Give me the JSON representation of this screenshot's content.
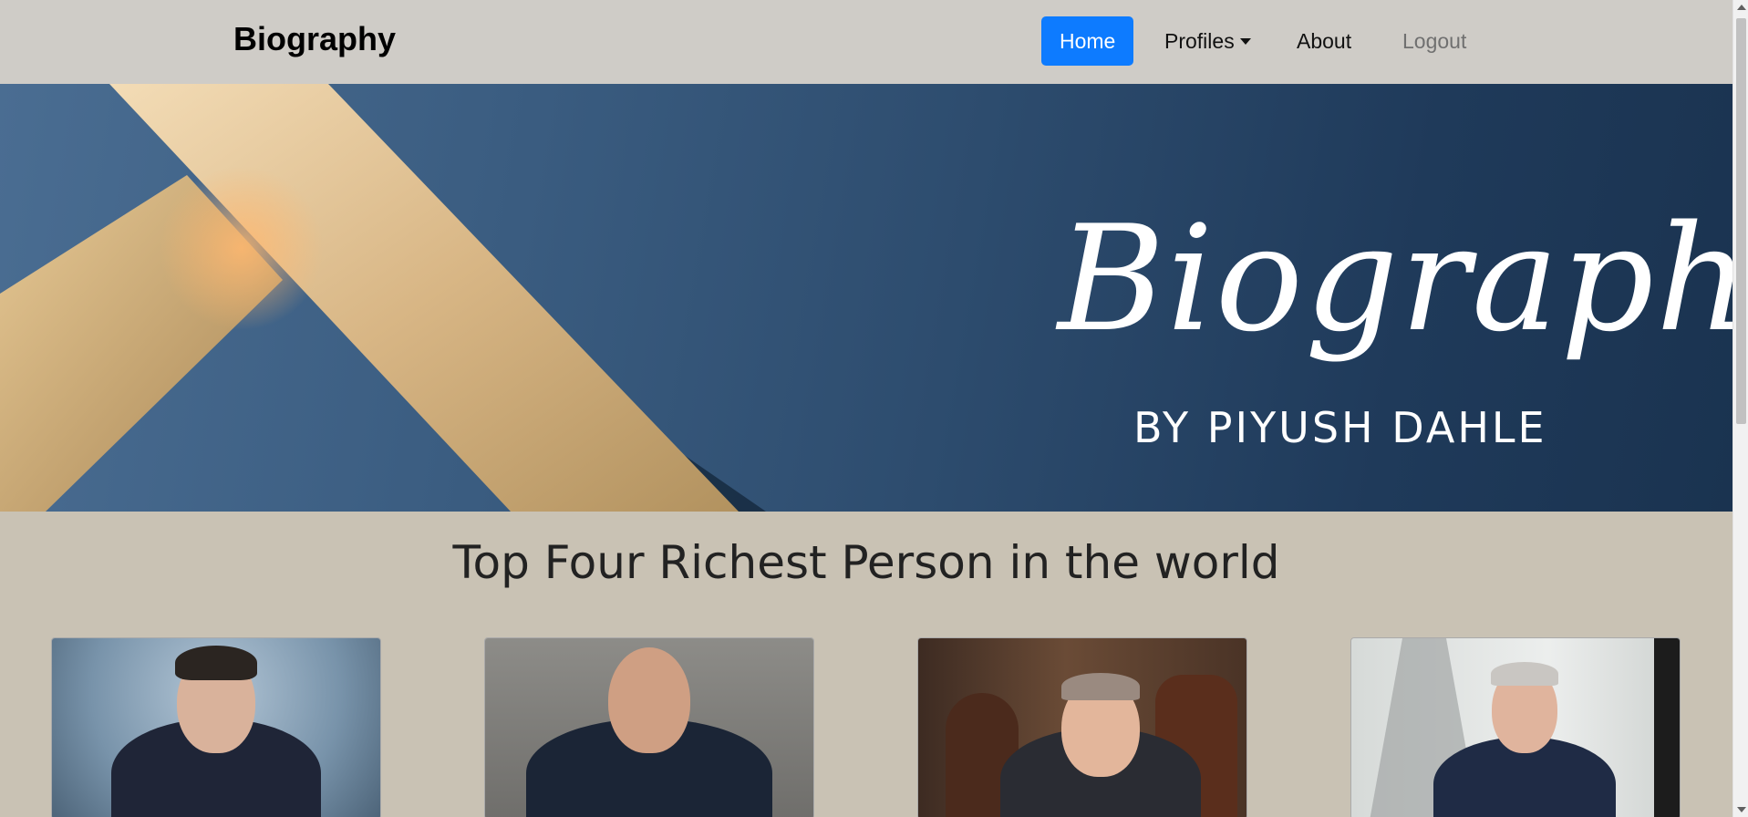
{
  "navbar": {
    "brand": "Biography",
    "links": [
      {
        "label": "Home"
      },
      {
        "label": "Profiles"
      },
      {
        "label": "About"
      },
      {
        "label": "Logout"
      }
    ]
  },
  "hero": {
    "signature": "Biography",
    "byline": "BY PIYUSH DAHLE"
  },
  "section": {
    "title": "Top Four Richest Person in the world"
  },
  "cards": [
    {
      "image": "portrait-photo"
    },
    {
      "image": "portrait-photo"
    },
    {
      "image": "portrait-photo"
    },
    {
      "image": "portrait-photo"
    }
  ],
  "colors": {
    "nav_bg": "#cfccc7",
    "active_link": "#0d7bff",
    "page_bg": "#c9c2b4",
    "hero_blue": "#2d4c6e",
    "hero_gold": "#d9b98a"
  }
}
